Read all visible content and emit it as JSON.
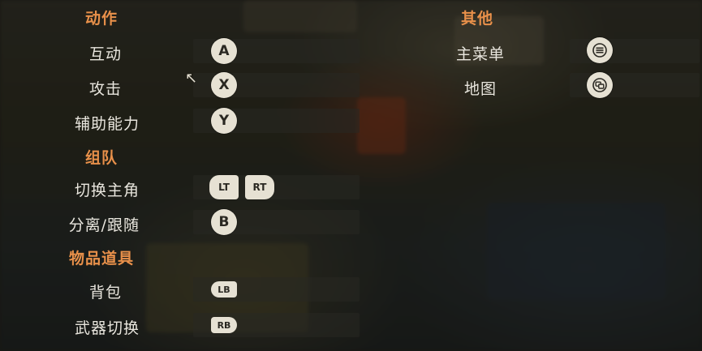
{
  "sections": {
    "actions": {
      "title": "动作",
      "rows": [
        {
          "label": "互动",
          "button": "A"
        },
        {
          "label": "攻击",
          "button": "X"
        },
        {
          "label": "辅助能力",
          "button": "Y"
        }
      ]
    },
    "team": {
      "title": "组队",
      "rows": [
        {
          "label": "切换主角",
          "buttons": [
            "LT",
            "RT"
          ]
        },
        {
          "label": "分离/跟随",
          "button": "B"
        }
      ]
    },
    "items": {
      "title": "物品道具",
      "rows": [
        {
          "label": "背包",
          "button": "LB"
        },
        {
          "label": "武器切换",
          "button": "RB"
        }
      ]
    },
    "other": {
      "title": "其他",
      "rows": [
        {
          "label": "主菜单",
          "icon": "menu-icon"
        },
        {
          "label": "地图",
          "icon": "view-icon"
        }
      ]
    }
  },
  "colors": {
    "section_title": "#e8904a",
    "label": "#e9e6de",
    "button_face": "#e6e1d3",
    "button_glyph": "#2a2822"
  }
}
